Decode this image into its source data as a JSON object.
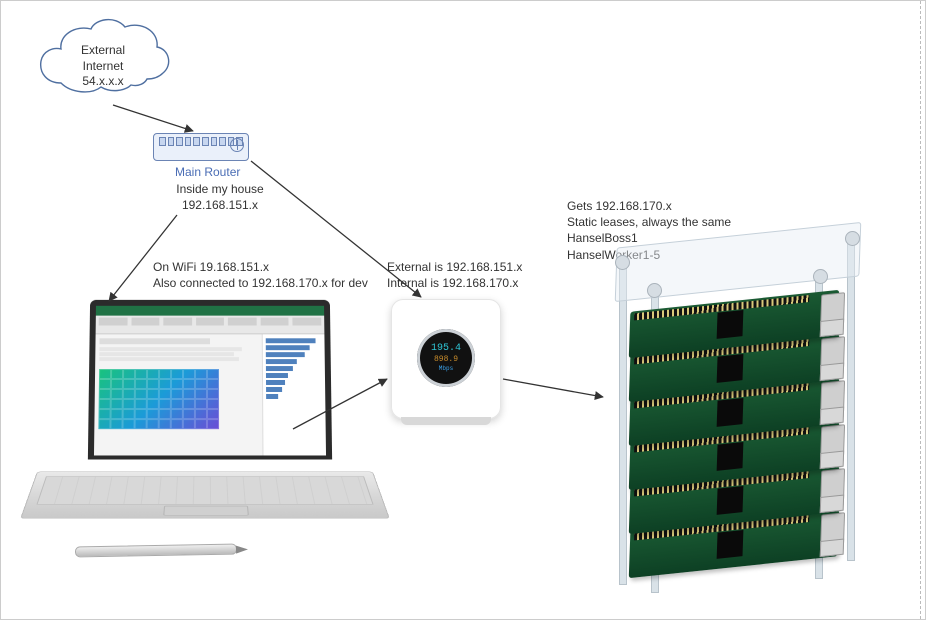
{
  "cloud": {
    "line1": "External",
    "line2": "Internet",
    "line3": "54.x.x.x"
  },
  "router": {
    "label": "Main Router",
    "note1": "Inside my house",
    "note2": "192.168.151.x"
  },
  "laptop_note": "On WiFi 19.168.151.x\nAlso connected to 192.168.170.x for dev",
  "ap_note": "External is 192.168.151.x\nInternal is 192.168.170.x",
  "ap_display": {
    "main": "195.4",
    "sub": "898.9",
    "unit": "Mbps"
  },
  "cluster_note": "Gets 192.168.170.x\nStatic leases, always the same\nHanselBoss1\nHanselWorker1-5"
}
